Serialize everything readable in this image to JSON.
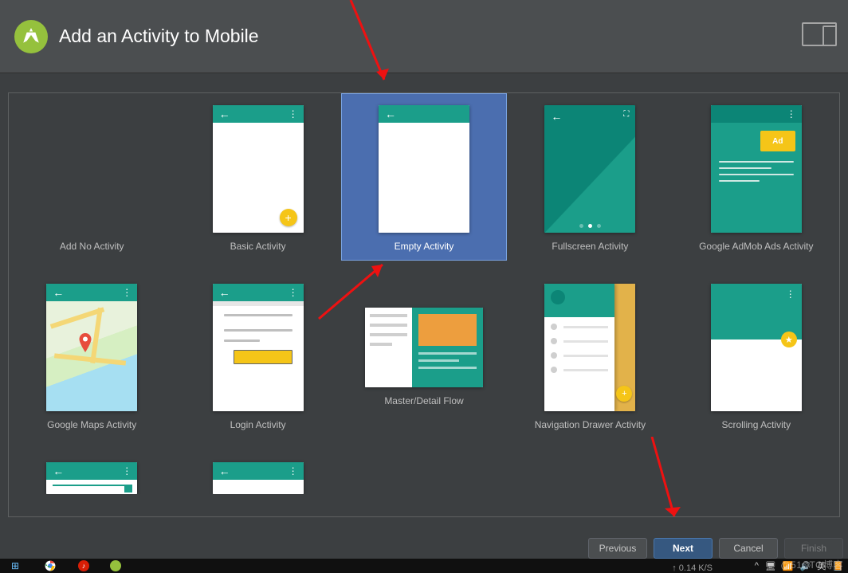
{
  "header": {
    "title": "Add an Activity to Mobile"
  },
  "tiles": {
    "add_no_activity": "Add No Activity",
    "basic": "Basic Activity",
    "empty": "Empty Activity",
    "fullscreen": "Fullscreen Activity",
    "admob": "Google AdMob Ads Activity",
    "maps": "Google Maps Activity",
    "login": "Login Activity",
    "master_detail": "Master/Detail Flow",
    "nav_drawer": "Navigation Drawer Activity",
    "scrolling": "Scrolling Activity"
  },
  "ad_label": "Ad",
  "footer": {
    "previous": "Previous",
    "next": "Next",
    "cancel": "Cancel",
    "finish": "Finish"
  },
  "watermark": "@51CTO博客",
  "netspeed": "↑ 0.14 K/S"
}
